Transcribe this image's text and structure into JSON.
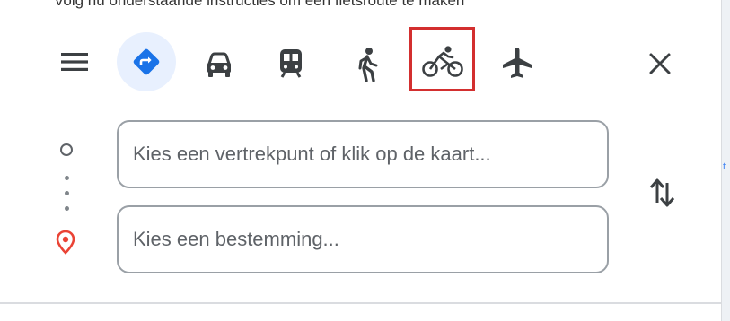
{
  "caption": {
    "text": "Volg nu onderstaande instructies om een fietsroute te maken"
  },
  "toolbar": {
    "menu_icon": "hamburger-menu-icon",
    "modes": [
      {
        "id": "best",
        "icon": "directions-diamond-icon",
        "selected": true
      },
      {
        "id": "driving",
        "icon": "car-icon",
        "selected": false
      },
      {
        "id": "transit",
        "icon": "train-icon",
        "selected": false
      },
      {
        "id": "walking",
        "icon": "walking-person-icon",
        "selected": false
      },
      {
        "id": "cycling",
        "icon": "bicycle-icon",
        "selected": false,
        "highlighted": true
      },
      {
        "id": "flights",
        "icon": "airplane-icon",
        "selected": false
      }
    ],
    "close_icon": "close-x-icon"
  },
  "route": {
    "origin": {
      "value": "",
      "placeholder": "Kies een vertrekpunt of klik op de kaart..."
    },
    "destination": {
      "value": "",
      "placeholder": "Kies een bestemming..."
    },
    "swap_icon": "swap-vertical-arrows-icon"
  },
  "colors": {
    "accent_blue": "#1a73e8",
    "selected_bg": "#e8f0fe",
    "icon_gray": "#3c4043",
    "highlight_red": "#d32f2f",
    "destination_red": "#ea4335"
  }
}
